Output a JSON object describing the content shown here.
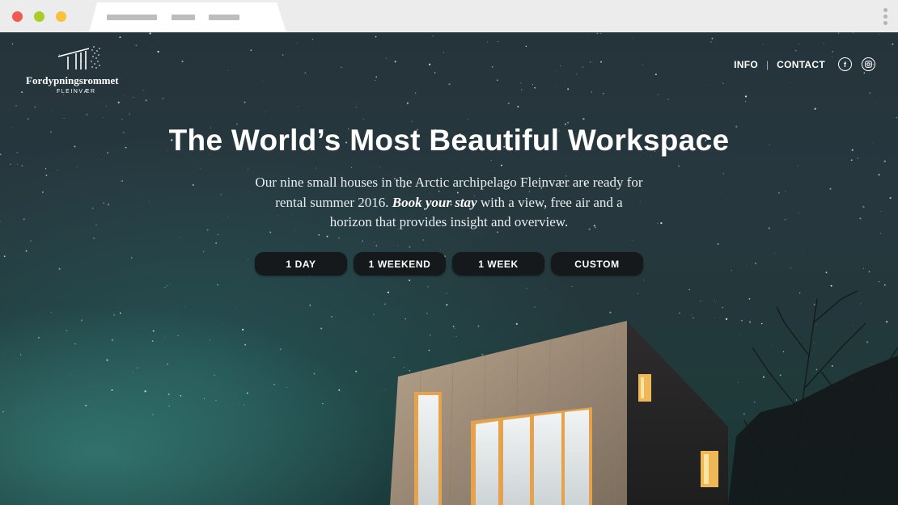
{
  "site": {
    "brand_name": "Fordypningsrommet",
    "brand_sub": "FLEINVÆR"
  },
  "nav": {
    "info": "INFO",
    "separator": "|",
    "contact": "CONTACT",
    "facebook_icon": "facebook-icon",
    "instagram_icon": "instagram-icon"
  },
  "hero": {
    "title": "The World’s Most Beautiful Workspace",
    "lede_part1": "Our nine small houses in the Arctic archipelago Fleinvær are ready for rental summer 2016. ",
    "lede_emphasis": "Book your stay",
    "lede_part2": " with a view, free air and a horizon that provides insight and overview."
  },
  "booking_options": [
    "1 DAY",
    "1 WEEKEND",
    "1 WEEK",
    "CUSTOM"
  ],
  "colors": {
    "chrome_bg": "#ececec",
    "window_red": "#f05a4f",
    "window_green": "#a7cd26",
    "window_yellow": "#f7c23a",
    "sky": "#25343b",
    "button_bg": "#15191c",
    "window_light": "#f0c46a"
  }
}
